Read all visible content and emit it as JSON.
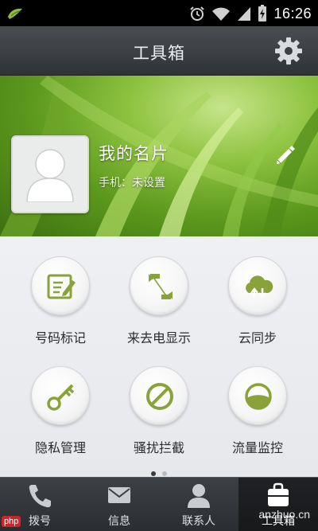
{
  "status_bar": {
    "time": "16:26"
  },
  "header": {
    "title": "工具箱",
    "settings_icon": "gear-icon"
  },
  "profile": {
    "title": "我的名片",
    "phone_text": "手机：未设置",
    "edit_icon": "pencil-icon"
  },
  "tools": [
    {
      "label": "号码标记",
      "icon": "edit-note-icon"
    },
    {
      "label": "来去电显示",
      "icon": "call-display-icon"
    },
    {
      "label": "云同步",
      "icon": "cloud-sync-icon"
    },
    {
      "label": "隐私管理",
      "icon": "key-icon"
    },
    {
      "label": "骚扰拦截",
      "icon": "block-icon"
    },
    {
      "label": "流量监控",
      "icon": "traffic-gauge-icon"
    }
  ],
  "pager": {
    "pages": 2,
    "current": 1
  },
  "tabs": [
    {
      "label": "拨号",
      "icon": "phone-icon"
    },
    {
      "label": "信息",
      "icon": "envelope-icon"
    },
    {
      "label": "联系人",
      "icon": "contact-icon"
    },
    {
      "label": "工具箱",
      "icon": "toolbox-icon",
      "active": true
    }
  ],
  "watermark": {
    "badge": "php",
    "site": "anzhuo.cn"
  },
  "colors": {
    "accent_green": "#8aa23a",
    "tab_bar": "#2f3236",
    "title_bar": "#3c4044"
  }
}
